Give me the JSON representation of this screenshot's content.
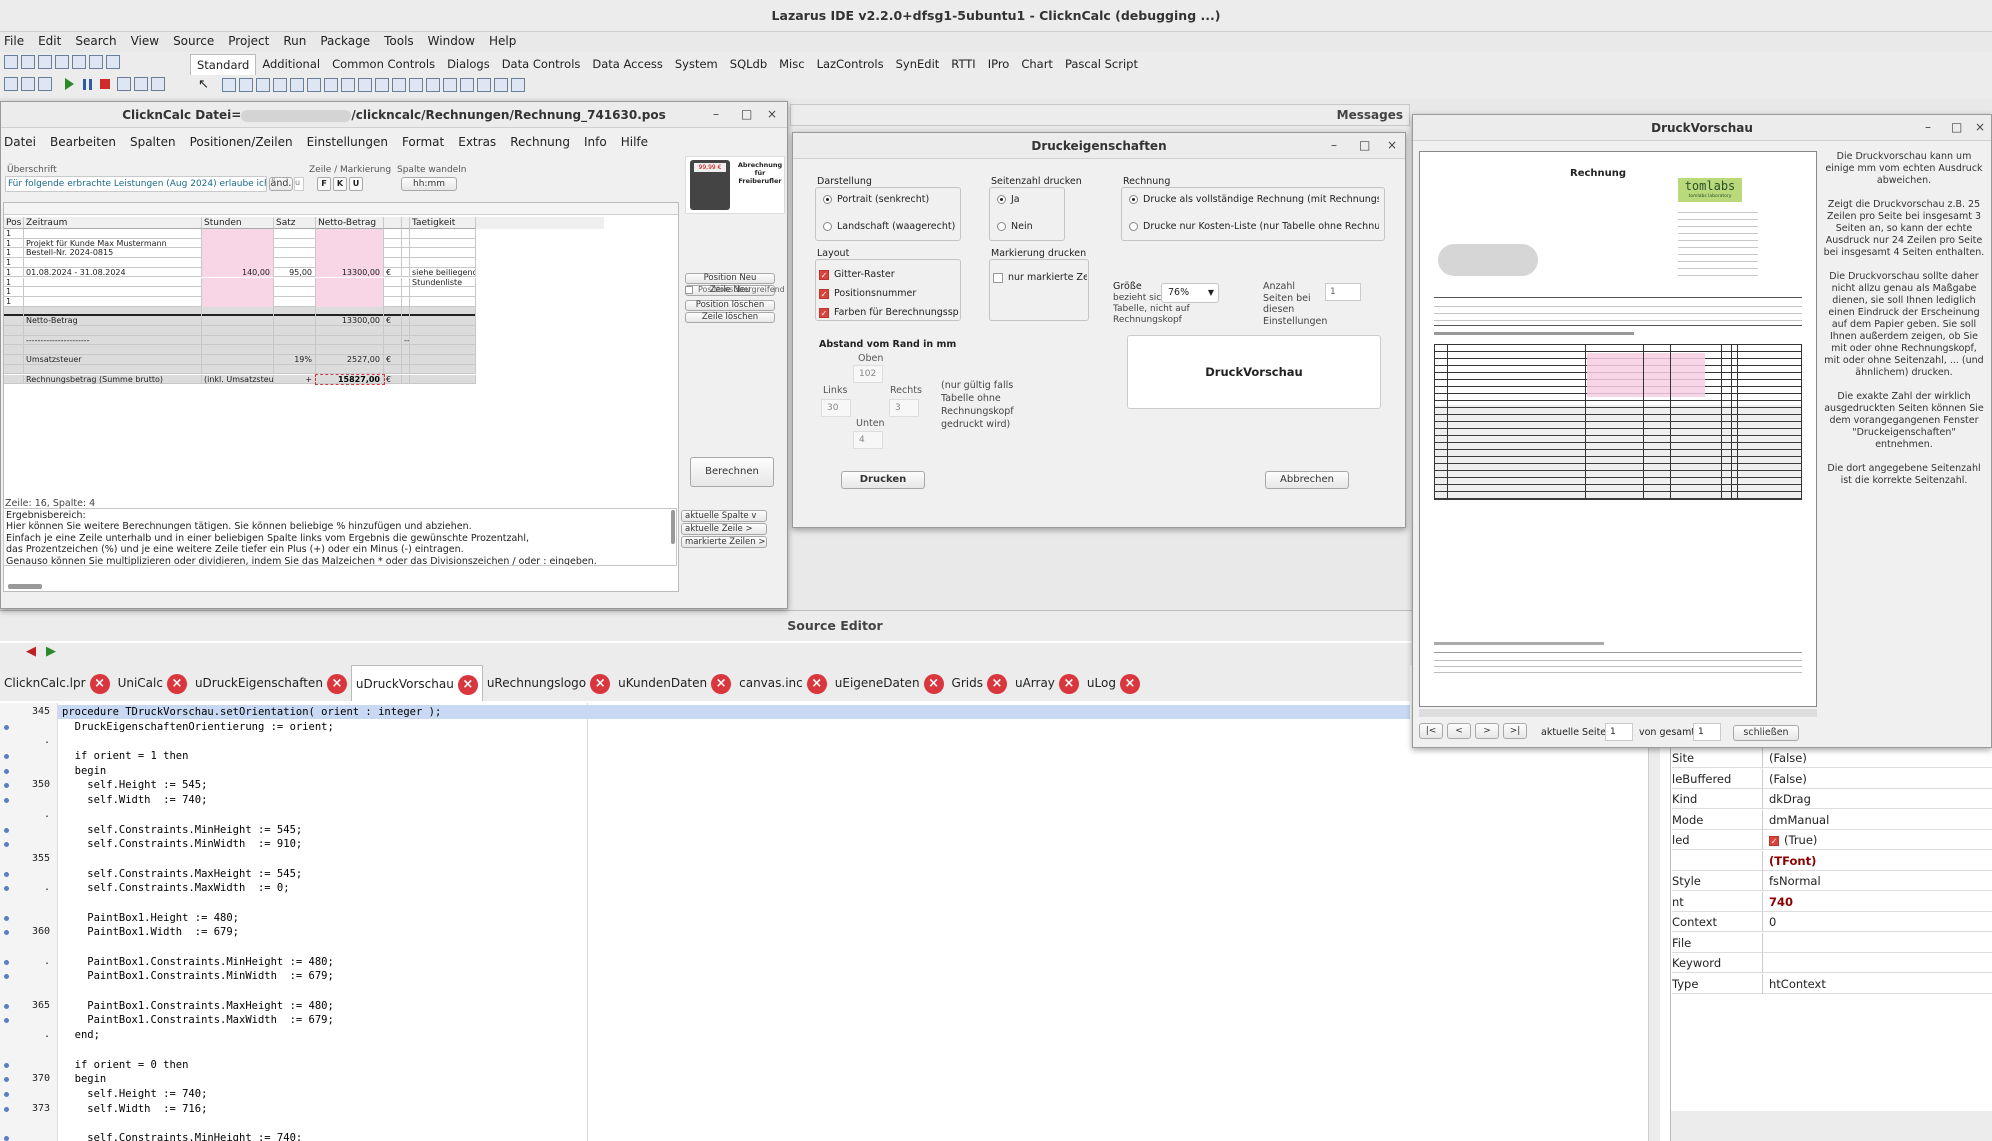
{
  "ide": {
    "title": "Lazarus IDE v2.2.0+dfsg1-5ubuntu1 - ClicknCalc (debugging ...)",
    "menu": [
      "File",
      "Edit",
      "Search",
      "View",
      "Source",
      "Project",
      "Run",
      "Package",
      "Tools",
      "Window",
      "Help"
    ],
    "palette_tabs": [
      "Standard",
      "Additional",
      "Common Controls",
      "Dialogs",
      "Data Controls",
      "Data Access",
      "System",
      "SQLdb",
      "Misc",
      "LazControls",
      "SynEdit",
      "RTTI",
      "IPro",
      "Chart",
      "Pascal Script"
    ],
    "active_palette_tab": "Standard"
  },
  "messages": {
    "title": "Messages"
  },
  "clickncalc": {
    "title_prefix": "ClicknCalc Datei=",
    "title_suffix": "/clickncalc/Rechnungen/Rechnung_741630.pos",
    "menu": [
      "Datei",
      "Bearbeiten",
      "Spalten",
      "Positionen/Zeilen",
      "Einstellungen",
      "Format",
      "Extras",
      "Rechnung",
      "Info",
      "Hilfe"
    ],
    "ueberschrift_label": "Überschrift",
    "ueberschrift_value": "Für folgende erbrachte Leistungen (Aug 2024) erlaube ich",
    "aend_label": "änd.",
    "zeile_markierung_label": "Zeile / Markierung",
    "fmt_buttons": [
      "F",
      "K",
      "U"
    ],
    "spalte_wandeln_label": "Spalte wandeln",
    "hhmm": "hh:mm",
    "logo_caption": "Abrechnung für Freiberufler",
    "logo_display": "99,99 €",
    "columns": [
      "Pos",
      "Zeitraum",
      "Stunden",
      "Satz Euro",
      "Netto-Betrag",
      "",
      "",
      "Taetigkeit"
    ],
    "rows": [
      [
        "1",
        "",
        "",
        "",
        "",
        "",
        "",
        ""
      ],
      [
        "1",
        "Projekt für Kunde Max Mustermann",
        "",
        "",
        "",
        "",
        "",
        ""
      ],
      [
        "1",
        "Bestell-Nr. 2024-0815",
        "",
        "",
        "",
        "",
        "",
        ""
      ],
      [
        "1",
        "",
        "",
        "",
        "",
        "",
        "",
        ""
      ],
      [
        "1",
        "01.08.2024 - 31.08.2024",
        "140,00",
        "95,00",
        "13300,00",
        "€",
        "",
        "siehe beiliegende"
      ],
      [
        "1",
        "",
        "",
        "",
        "",
        "",
        "",
        "Stundenliste"
      ],
      [
        "1",
        "",
        "",
        "",
        "",
        "",
        "",
        ""
      ],
      [
        "1",
        "",
        "",
        "",
        "",
        "",
        "",
        ""
      ],
      [
        "",
        "",
        "",
        "",
        "",
        "",
        "",
        ""
      ],
      [
        "",
        "Netto-Betrag",
        "",
        "",
        "13300,00",
        "€",
        "",
        ""
      ],
      [
        "",
        "",
        "",
        "",
        "",
        "",
        "",
        ""
      ],
      [
        "",
        "----------------------",
        "",
        "",
        "",
        "",
        "----",
        ""
      ],
      [
        "",
        "",
        "",
        "",
        "",
        "",
        "",
        ""
      ],
      [
        "",
        "Umsatzsteuer",
        "",
        "19%",
        "2527,00",
        "€",
        "",
        ""
      ],
      [
        "",
        "",
        "",
        "",
        "",
        "",
        "",
        ""
      ],
      [
        "",
        "Rechnungsbetrag  (Summe brutto)",
        "(inkl. Umsatzsteuer)",
        "+",
        "15827,00",
        "€",
        "",
        ""
      ]
    ],
    "side_buttons": [
      "Position Neu",
      "Zeile Neu",
      "Position löschen",
      "Zeile löschen"
    ],
    "positionsuebergreifend": "Positionsübergreifend",
    "berechnen": "Berechnen",
    "status": "Zeile: 16, Spalte: 4",
    "ergebnis_lines": [
      "Ergebnisbereich:",
      "Hier können Sie weitere Berechnungen tätigen. Sie können beliebige % hinzufügen und abziehen.",
      "Einfach je eine Zeile unterhalb und in einer beliebigen Spalte links vom Ergebnis die gewünschte Prozentzahl,",
      "das Prozentzeichen (%) und je eine weitere Zeile tiefer ein Plus (+) oder ein Minus (-) eintragen.",
      "Genauso können Sie multiplizieren oder dividieren, indem Sie das Malzeichen * oder das Divisionszeichen / oder : eingeben."
    ],
    "bottom_buttons": [
      "aktuelle Spalte  v",
      "aktuelle Zeile    >",
      "markierte Zeilen >"
    ]
  },
  "druck": {
    "title": "Druckeigenschaften",
    "darstellung": "Darstellung",
    "portrait": "Portrait (senkrecht)",
    "landschaft": "Landschaft (waagerecht)",
    "seitenzahl": "Seitenzahl drucken",
    "ja": "Ja",
    "nein": "Nein",
    "rechnung": "Rechnung",
    "rechnung_opt1": "Drucke als vollständige Rechnung (mit Rechnungsk",
    "rechnung_opt2": "Drucke nur Kosten-Liste (nur Tabelle ohne Rechnun",
    "layout": "Layout",
    "gitter": "Gitter-Raster",
    "posnr": "Positionsnummer",
    "farben": "Farben für Berechnungsspalt",
    "markierung": "Markierung drucken",
    "nur_markierte": "nur markierte Zeile",
    "groesse": "Größe",
    "groesse_note": "bezieht sich nur auf Tabelle, nicht auf Rechnungskopf",
    "zoom": "76%",
    "anzahl_seiten": "Anzahl Seiten bei diesen Einstellungen",
    "anzahl_value": "1",
    "abstand": "Abstand vom Rand in mm",
    "oben": "Oben",
    "oben_v": "102",
    "links": "Links",
    "links_v": "30",
    "rechts": "Rechts",
    "rechts_v": "3",
    "unten": "Unten",
    "unten_v": "4",
    "note": "(nur gültig falls Tabelle ohne Rechnungskopf gedruckt wird)",
    "druckvorschau_btn": "DruckVorschau",
    "drucken": "Drucken",
    "abbrechen": "Abbrechen"
  },
  "vorschau": {
    "title": "DruckVorschau",
    "page_title": "Rechnung",
    "logo": "tomlabs",
    "logo_sub": "tomlabs laboratory",
    "nav": [
      "|<",
      "<",
      ">",
      ">|"
    ],
    "aktuelle_seite": "aktuelle Seite",
    "aktuelle_v": "1",
    "von_gesamt": "von gesamt",
    "gesamt_v": "1",
    "schliessen": "schließen",
    "help": [
      "Die Druckvorschau kann um einige mm vom echten Ausdruck abweichen.",
      "Zeigt die Druckvorschau z.B. 25 Zeilen pro Seite bei insgesamt 3 Seiten an, so kann der echte Ausdruck nur 24 Zeilen pro Seite bei insgesamt 4 Seiten enthalten.",
      "Die Druckvorschau sollte daher nicht allzu genau als Maßgabe dienen, sie soll Ihnen lediglich einen Eindruck der Erscheinung auf dem Papier geben. Sie soll Ihnen außerdem zeigen, ob Sie mit oder ohne Rechnungskopf, mit oder ohne Seitenzahl, ... (und ähnlichem) drucken.",
      "Die exakte Zahl der wirklich ausgedruckten Seiten können Sie dem vorangegangenen Fenster \"Druckeigenschaften\" entnehmen.",
      "Die dort angegebene Seitenzahl ist die korrekte Seitenzahl."
    ]
  },
  "editor": {
    "title": "Source Editor",
    "tabs": [
      {
        "label": "ClicknCalc.lpr",
        "active": false
      },
      {
        "label": "UniCalc",
        "active": false
      },
      {
        "label": "uDruckEigenschaften",
        "active": false
      },
      {
        "label": "uDruckVorschau",
        "active": true
      },
      {
        "label": "uRechnungslogo",
        "active": false
      },
      {
        "label": "uKundenDaten",
        "active": false
      },
      {
        "label": "canvas.inc",
        "active": false
      },
      {
        "label": "uEigeneDaten",
        "active": false
      },
      {
        "label": "Grids",
        "active": false
      },
      {
        "label": "uArray",
        "active": false
      },
      {
        "label": "uLog",
        "active": false
      }
    ],
    "line_numbers": [
      "345",
      "",
      "",
      "",
      "",
      "350",
      "",
      "",
      "",
      "",
      "355",
      "",
      "",
      "",
      "",
      "360",
      "",
      "",
      "",
      "",
      "365",
      "",
      "",
      "",
      "",
      "370",
      "",
      "373"
    ],
    "lines": [
      "procedure TDruckVorschau.setOrientation( orient : integer );",
      "  DruckEigenschaftenOrientierung := orient;",
      "",
      "  if orient = 1 then",
      "  begin",
      "    self.Height := 545;",
      "    self.Width  := 740;",
      "",
      "    self.Constraints.MinHeight := 545;",
      "    self.Constraints.MinWidth  := 910;",
      "",
      "    self.Constraints.MaxHeight := 545;",
      "    self.Constraints.MaxWidth  := 0;",
      "",
      "    PaintBox1.Height := 480;",
      "    PaintBox1.Width  := 679;",
      "",
      "    PaintBox1.Constraints.MinHeight := 480;",
      "    PaintBox1.Constraints.MinWidth  := 679;",
      "",
      "    PaintBox1.Constraints.MaxHeight := 480;",
      "    PaintBox1.Constraints.MaxWidth  := 679;",
      "  end;",
      "",
      "  if orient = 0 then",
      "  begin",
      "    self.Height := 740;",
      "    self.Width  := 716;",
      "",
      "    self.Constraints.MinHeight := 740;"
    ]
  },
  "inspector": {
    "rows": [
      {
        "k": "Site",
        "v": "(False)"
      },
      {
        "k": "leBuffered",
        "v": "(False)"
      },
      {
        "k": "Kind",
        "v": "dkDrag"
      },
      {
        "k": "Mode",
        "v": "dmManual"
      },
      {
        "k": "led",
        "v": "(True)",
        "checked": true
      },
      {
        "k": "",
        "v": "(TFont)",
        "accent": true
      },
      {
        "k": "Style",
        "v": "fsNormal"
      },
      {
        "k": "nt",
        "v": "740",
        "accent": true
      },
      {
        "k": "Context",
        "v": "0"
      },
      {
        "k": "File",
        "v": ""
      },
      {
        "k": "Keyword",
        "v": ""
      },
      {
        "k": "Type",
        "v": "htContext"
      }
    ]
  },
  "colors": {
    "accent": "#8b0000",
    "pink": "#f9d6e6",
    "close_red": "#d9363e",
    "selection": "#c9d9f3"
  }
}
